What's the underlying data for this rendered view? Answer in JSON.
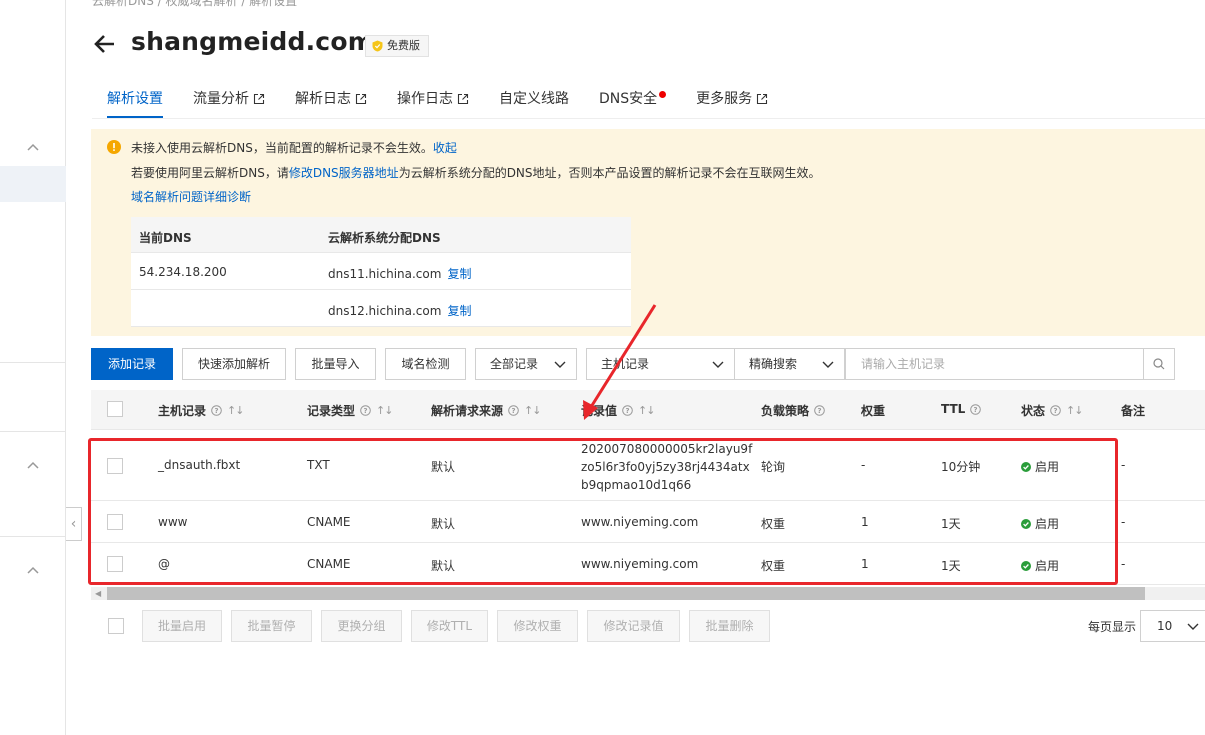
{
  "breadcrumb": "云解析DNS  /  权威域名解析  /  解析设置",
  "header": {
    "title": "shangmeidd.com",
    "badge": "免费版"
  },
  "tabs": [
    {
      "label": "解析设置",
      "active": true,
      "external": false
    },
    {
      "label": "流量分析",
      "active": false,
      "external": true
    },
    {
      "label": "解析日志",
      "active": false,
      "external": true
    },
    {
      "label": "操作日志",
      "active": false,
      "external": true
    },
    {
      "label": "自定义线路",
      "active": false,
      "external": false
    },
    {
      "label": "DNS安全",
      "active": false,
      "external": false,
      "dot": true
    },
    {
      "label": "更多服务",
      "active": false,
      "external": true
    }
  ],
  "notice": {
    "line1": "未接入使用云解析DNS，当前配置的解析记录不会生效。",
    "line1_link": "收起",
    "line2_pre": "若要使用阿里云解析DNS，请",
    "line2_link": "修改DNS服务器地址",
    "line2_post": "为云解析系统分配的DNS地址，否则本产品设置的解析记录不会在互联网生效。",
    "line3_link": "域名解析问题详细诊断",
    "dns_table": {
      "headers": [
        "当前DNS",
        "云解析系统分配DNS"
      ],
      "rows": [
        {
          "current": "54.234.18.200",
          "assigned": "dns11.hichina.com",
          "copy": "复制"
        },
        {
          "current": "",
          "assigned": "dns12.hichina.com",
          "copy": "复制"
        }
      ]
    }
  },
  "toolbar": {
    "add": "添加记录",
    "quick_add": "快速添加解析",
    "import": "批量导入",
    "check": "域名检测",
    "filter_all": "全部记录",
    "host_field": "主机记录",
    "match_mode": "精确搜索",
    "search_placeholder": "请输入主机记录"
  },
  "table": {
    "headers": {
      "host": "主机记录",
      "type": "记录类型",
      "source": "解析请求来源",
      "value": "记录值",
      "policy": "负载策略",
      "weight": "权重",
      "ttl": "TTL",
      "status": "状态",
      "remark": "备注"
    },
    "rows": [
      {
        "host": "_dnsauth.fbxt",
        "type": "TXT",
        "source": "默认",
        "value_l1": "202007080000005kr2layu9f",
        "value_l2": "zo5l6r3fo0yj5zy38rj4434atx",
        "value_l3": "b9qpmao10d1q66",
        "policy": "轮询",
        "weight": "-",
        "ttl": "10分钟",
        "status": "启用",
        "remark": "-"
      },
      {
        "host": "www",
        "type": "CNAME",
        "source": "默认",
        "value_l1": "www.niyeming.com",
        "policy": "权重",
        "weight": "1",
        "ttl": "1天",
        "status": "启用",
        "remark": "-"
      },
      {
        "host": "@",
        "type": "CNAME",
        "source": "默认",
        "value_l1": "www.niyeming.com",
        "policy": "权重",
        "weight": "1",
        "ttl": "1天",
        "status": "启用",
        "remark": "-"
      }
    ]
  },
  "bulk_actions": [
    "批量启用",
    "批量暂停",
    "更换分组",
    "修改TTL",
    "修改权重",
    "修改记录值",
    "批量删除"
  ],
  "pager": {
    "label": "每页显示",
    "size": "10"
  },
  "colors": {
    "accent": "#0064c8",
    "highlight": "#e8262b",
    "notice_bg": "#fdf5e0",
    "status_ok": "#2a9d3a"
  }
}
